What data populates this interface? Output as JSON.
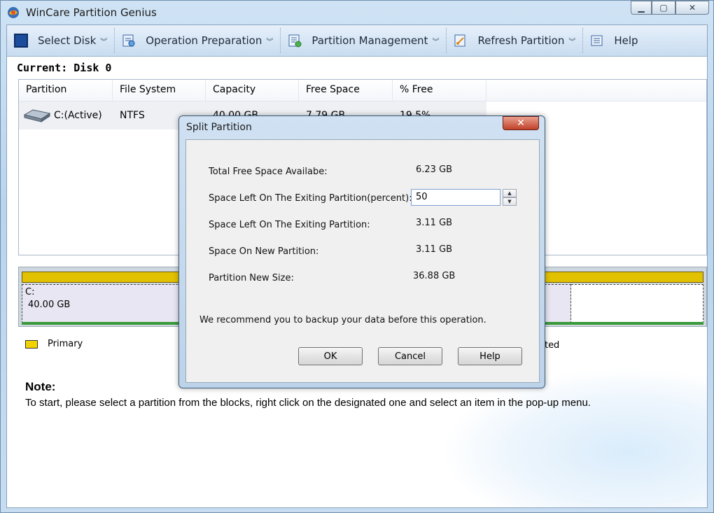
{
  "window": {
    "title": "WinCare Partition Genius"
  },
  "toolbar": {
    "select_disk": "Select Disk",
    "operation_preparation": "Operation Preparation",
    "partition_management": "Partition Management",
    "refresh_partition": "Refresh Partition",
    "help": "Help"
  },
  "current": "Current: Disk 0",
  "table": {
    "headers": [
      "Partition",
      "File System",
      "Capacity",
      "Free Space",
      "% Free"
    ],
    "rows": [
      {
        "partition": "C:(Active)",
        "file_system": "NTFS",
        "capacity": "40.00 GB",
        "free_space": "7.79 GB",
        "pct_free": "19.5%"
      }
    ]
  },
  "diskmap": {
    "drive": "C:",
    "size": "40.00 GB"
  },
  "legend": {
    "primary": "Primary",
    "other_partial": "ated"
  },
  "note": {
    "title": "Note:",
    "text": "To start, please select a partition from the blocks, right click on the designated one and select an item in the pop-up menu."
  },
  "dialog": {
    "title": "Split Partition",
    "total_free_label": "Total Free Space Availabe:",
    "total_free_value": "6.23 GB",
    "percent_label": "Space Left On The Exiting Partition(percent):",
    "percent_value": "50",
    "space_left_label": "Space Left On The Exiting Partition:",
    "space_left_value": "3.11 GB",
    "new_partition_label": "Space On New Partition:",
    "new_partition_value": "3.11 GB",
    "new_size_label": "Partition New Size:",
    "new_size_value": "36.88 GB",
    "recommend": "We recommend you to backup your data before this operation.",
    "ok": "OK",
    "cancel": "Cancel",
    "help": "Help"
  },
  "colors": {
    "primary_partition": "#f2d300",
    "toolbar_bg": "#c8dcf0",
    "close_button": "#c0412a"
  }
}
